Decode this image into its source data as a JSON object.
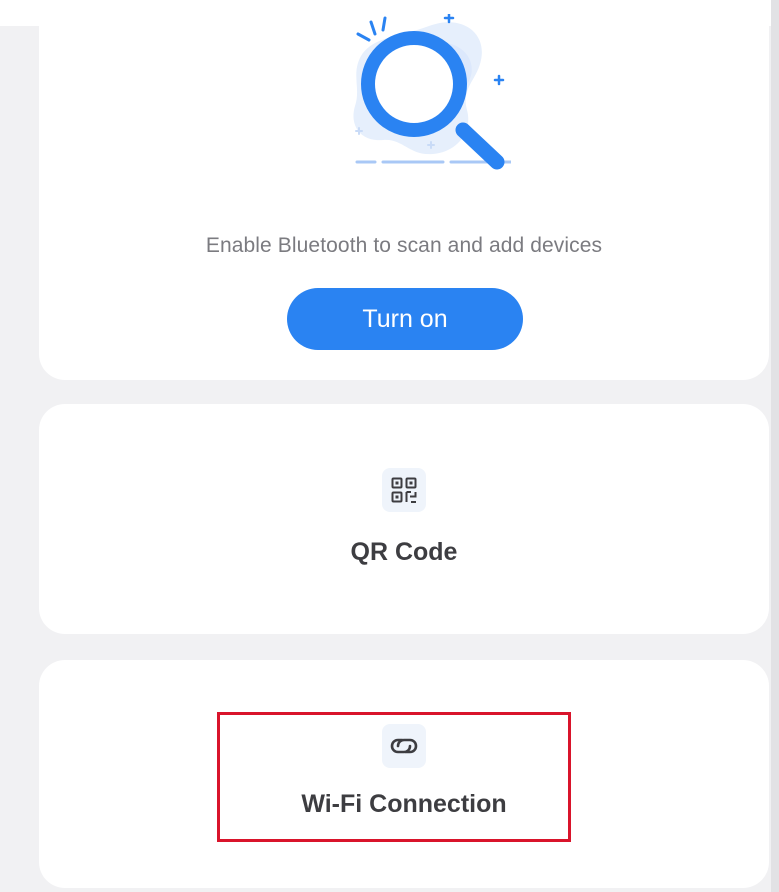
{
  "bluetooth": {
    "illustration_icon": "magnifier-search-icon",
    "message": "Enable Bluetooth to scan and add devices",
    "button_label": "Turn on"
  },
  "options": {
    "qr": {
      "icon": "qr-code-icon",
      "label": "QR Code"
    },
    "wifi": {
      "icon": "link-icon",
      "label": "Wi-Fi Connection"
    }
  },
  "colors": {
    "accent": "#2a83f2",
    "highlight": "#d9142b",
    "background": "#f1f1f3",
    "card": "#ffffff"
  }
}
